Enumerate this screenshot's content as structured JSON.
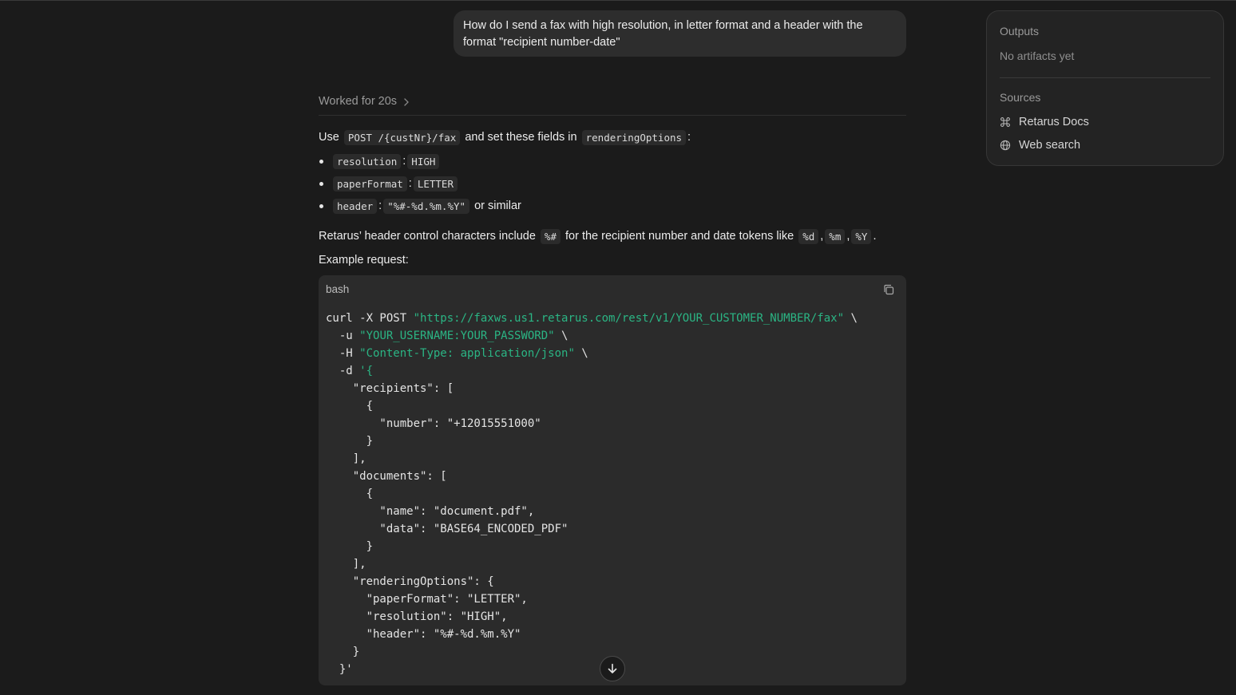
{
  "user_message": {
    "line1": "How do I send a fax with high resolution, in letter format and a header with the",
    "line2": "format \"recipient number-date\""
  },
  "worked": {
    "label": "Worked for 20s"
  },
  "answer": {
    "intro_prefix": "Use",
    "intro_code1": "POST /{custNr}/fax",
    "intro_mid": "and set these fields in",
    "intro_code2": "renderingOptions",
    "intro_suffix": ":",
    "bullets": [
      {
        "key": "resolution",
        "sep": ":",
        "value": "HIGH",
        "suffix": ""
      },
      {
        "key": "paperFormat",
        "sep": ":",
        "value": "LETTER",
        "suffix": ""
      },
      {
        "key": "header",
        "sep": ":",
        "value": "\"%#-%d.%m.%Y\"",
        "suffix": "or similar"
      }
    ],
    "note_prefix": "Retarus’ header control characters include",
    "note_code1": "%#",
    "note_mid": "for the recipient number and date tokens like",
    "note_code2": "%d",
    "note_comma1": ",",
    "note_code3": "%m",
    "note_comma2": ",",
    "note_code4": "%Y",
    "note_end": ".",
    "example_label": "Example request:"
  },
  "code_block": {
    "language": "bash",
    "lines": [
      {
        "pre": "curl -X POST ",
        "str": "\"https://faxws.us1.retarus.com/rest/v1/YOUR_CUSTOMER_NUMBER/fax\"",
        "post": " \\"
      },
      {
        "pre": "  -u ",
        "str": "\"YOUR_USERNAME:YOUR_PASSWORD\"",
        "post": " \\"
      },
      {
        "pre": "  -H ",
        "str": "\"Content-Type: application/json\"",
        "post": " \\"
      },
      {
        "pre": "  -d ",
        "str": "'{",
        "post": ""
      },
      {
        "pre": "    \"recipients\": [",
        "str": "",
        "post": ""
      },
      {
        "pre": "      {",
        "str": "",
        "post": ""
      },
      {
        "pre": "        \"number\": \"+12015551000\"",
        "str": "",
        "post": ""
      },
      {
        "pre": "      }",
        "str": "",
        "post": ""
      },
      {
        "pre": "    ],",
        "str": "",
        "post": ""
      },
      {
        "pre": "    \"documents\": [",
        "str": "",
        "post": ""
      },
      {
        "pre": "      {",
        "str": "",
        "post": ""
      },
      {
        "pre": "        \"name\": \"document.pdf\",",
        "str": "",
        "post": ""
      },
      {
        "pre": "        \"data\": \"BASE64_ENCODED_PDF\"",
        "str": "",
        "post": ""
      },
      {
        "pre": "      }",
        "str": "",
        "post": ""
      },
      {
        "pre": "    ],",
        "str": "",
        "post": ""
      },
      {
        "pre": "    \"renderingOptions\": {",
        "str": "",
        "post": ""
      },
      {
        "pre": "      \"paperFormat\": \"LETTER\",",
        "str": "",
        "post": ""
      },
      {
        "pre": "      \"resolution\": \"HIGH\",",
        "str": "",
        "post": ""
      },
      {
        "pre": "      \"header\": \"%#-%d.%m.%Y\"",
        "str": "",
        "post": ""
      },
      {
        "pre": "    }",
        "str": "",
        "post": ""
      },
      {
        "pre": "  }'",
        "str": "",
        "post": ""
      }
    ]
  },
  "side_panel": {
    "outputs_heading": "Outputs",
    "outputs_empty": "No artifacts yet",
    "sources_heading": "Sources",
    "sources": [
      {
        "label": "Retarus Docs",
        "icon": "command-icon"
      },
      {
        "label": "Web search",
        "icon": "globe-icon"
      }
    ]
  },
  "colors": {
    "background": "#1b1b1b",
    "string": "#2bb584",
    "code_bg": "#2b2b2b"
  }
}
